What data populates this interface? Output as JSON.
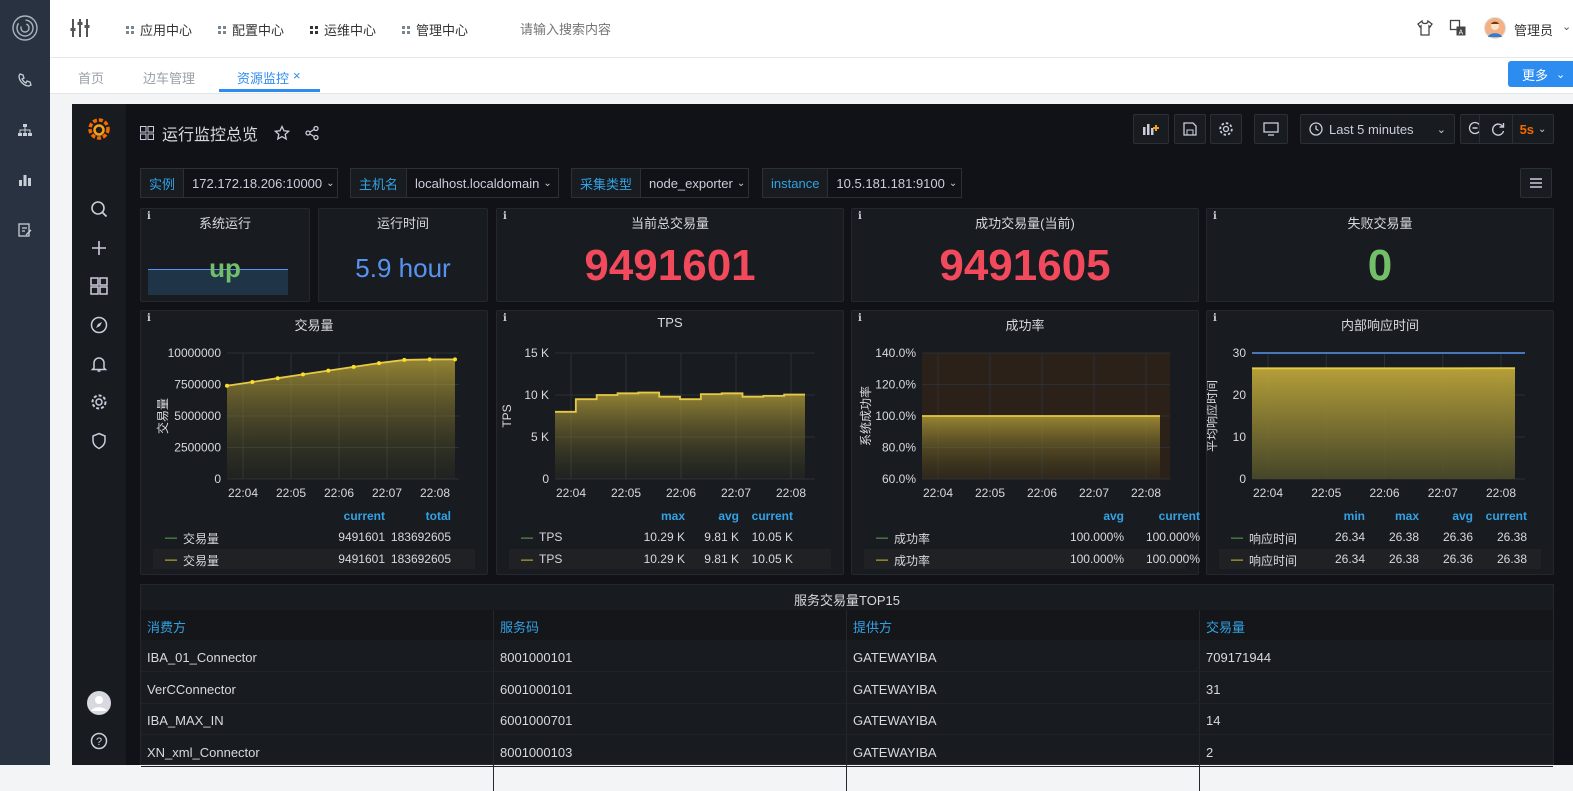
{
  "app": {
    "nav": [
      {
        "label": "应用中心"
      },
      {
        "label": "配置中心"
      },
      {
        "label": "运维中心"
      },
      {
        "label": "管理中心"
      }
    ],
    "search_placeholder": "请输入搜索内容",
    "user": "管理员",
    "tabs": [
      {
        "label": "首页"
      },
      {
        "label": "边车管理"
      },
      {
        "label": "资源监控"
      }
    ],
    "more_label": "更多"
  },
  "dashboard": {
    "title": "运行监控总览",
    "time_range": "Last 5 minutes",
    "refresh": "5s",
    "variables": [
      {
        "label": "实例",
        "value": "172.172.18.206:10000"
      },
      {
        "label": "主机名",
        "value": "localhost.localdomain"
      },
      {
        "label": "采集类型",
        "value": "node_exporter"
      },
      {
        "label": "instance",
        "value": "10.5.181.181:9100"
      }
    ]
  },
  "stats": [
    {
      "title": "系统运行",
      "value": "up",
      "color": "#73bf69"
    },
    {
      "title": "运行时间",
      "value": "5.9 hour",
      "color": "#5794f2"
    },
    {
      "title": "当前总交易量",
      "value": "9491601",
      "color": "#f2495c"
    },
    {
      "title": "成功交易量(当前)",
      "value": "9491605",
      "color": "#f2495c"
    },
    {
      "title": "失败交易量",
      "value": "0",
      "color": "#73bf69"
    }
  ],
  "chart_data": [
    {
      "type": "line",
      "title": "交易量",
      "ylabel": "交易量",
      "ylim": [
        0,
        10000000
      ],
      "yticks": [
        "10000000",
        "7500000",
        "5000000",
        "2500000",
        "0"
      ],
      "x": [
        "22:04",
        "22:05",
        "22:06",
        "22:07",
        "22:08"
      ],
      "series": [
        {
          "name": "交易量",
          "values": [
            7400000,
            7700000,
            8000000,
            8300000,
            8600000,
            8900000,
            9200000,
            9450000,
            9490000,
            9491601
          ]
        }
      ],
      "legend_headers": [
        "current",
        "total"
      ],
      "legend_rows": [
        {
          "name": "交易量",
          "values": [
            "9491601",
            "183692605"
          ],
          "color": "#73bf69"
        },
        {
          "name": "交易量",
          "values": [
            "9491601",
            "183692605"
          ],
          "color": "#fade2a"
        }
      ]
    },
    {
      "type": "line",
      "title": "TPS",
      "ylabel": "TPS",
      "ylim": [
        0,
        15000
      ],
      "yticks": [
        "15 K",
        "10 K",
        "5 K",
        "0"
      ],
      "x": [
        "22:04",
        "22:05",
        "22:06",
        "22:07",
        "22:08"
      ],
      "series": [
        {
          "name": "TPS",
          "values": [
            8000,
            9500,
            10000,
            10200,
            10290,
            9800,
            9500,
            10100,
            10200,
            9800,
            9900,
            10050,
            10050
          ]
        }
      ],
      "legend_headers": [
        "max",
        "avg",
        "current"
      ],
      "legend_rows": [
        {
          "name": "TPS",
          "values": [
            "10.29 K",
            "9.81 K",
            "10.05 K"
          ],
          "color": "#73bf69"
        },
        {
          "name": "TPS",
          "values": [
            "10.29 K",
            "9.81 K",
            "10.05 K"
          ],
          "color": "#fade2a"
        }
      ]
    },
    {
      "type": "line",
      "title": "成功率",
      "ylabel": "系统成功率",
      "ylim": [
        60,
        140
      ],
      "yticks": [
        "140.0%",
        "120.0%",
        "100.0%",
        "80.0%",
        "60.0%"
      ],
      "x": [
        "22:04",
        "22:05",
        "22:06",
        "22:07",
        "22:08"
      ],
      "series": [
        {
          "name": "成功率",
          "values": [
            100,
            100,
            100,
            100,
            100
          ]
        }
      ],
      "legend_headers": [
        "avg",
        "current"
      ],
      "legend_rows": [
        {
          "name": "成功率",
          "values": [
            "100.000%",
            "100.000%"
          ],
          "color": "#73bf69"
        },
        {
          "name": "成功率",
          "values": [
            "100.000%",
            "100.000%"
          ],
          "color": "#fade2a"
        }
      ]
    },
    {
      "type": "line",
      "title": "内部响应时间",
      "ylabel": "平均响应时间",
      "ylim": [
        0,
        30
      ],
      "yticks": [
        "30",
        "20",
        "10",
        "0"
      ],
      "x": [
        "22:04",
        "22:05",
        "22:06",
        "22:07",
        "22:08"
      ],
      "series": [
        {
          "name": "响应时间",
          "values": [
            26.36,
            26.36,
            26.36,
            26.36,
            26.38
          ]
        }
      ],
      "legend_headers": [
        "min",
        "max",
        "avg",
        "current"
      ],
      "legend_rows": [
        {
          "name": "响应时间",
          "values": [
            "26.34",
            "26.38",
            "26.36",
            "26.38"
          ],
          "color": "#73bf69"
        },
        {
          "name": "响应时间",
          "values": [
            "26.34",
            "26.38",
            "26.36",
            "26.38"
          ],
          "color": "#fade2a"
        }
      ]
    }
  ],
  "table": {
    "title": "服务交易量TOP15",
    "headers": [
      "消费方",
      "服务码",
      "提供方",
      "交易量"
    ],
    "rows": [
      [
        "IBA_01_Connector",
        "8001000101",
        "GATEWAYIBA",
        "709171944"
      ],
      [
        "VerCConnector",
        "6001000101",
        "GATEWAYIBA",
        "31"
      ],
      [
        "IBA_MAX_IN",
        "6001000701",
        "GATEWAYIBA",
        "14"
      ],
      [
        "XN_xml_Connector",
        "8001000103",
        "GATEWAYIBA",
        "2"
      ]
    ]
  }
}
